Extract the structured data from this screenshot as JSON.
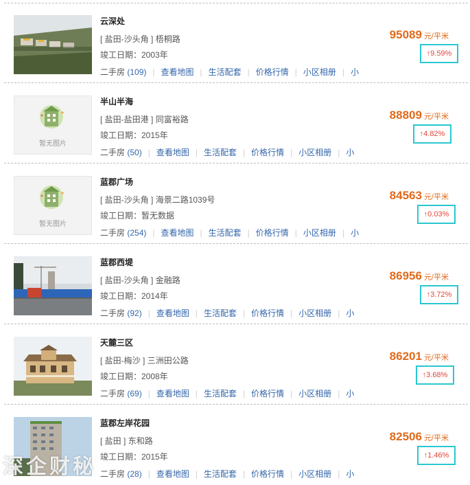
{
  "colors": {
    "price": "#e06a1b",
    "link": "#3366aa",
    "highlight_box": "#29c7d0",
    "change": "#e0453a"
  },
  "placeholder_text": "暂无图片",
  "unit": "元/平米",
  "links": {
    "second_hand": "二手房",
    "map": "查看地图",
    "life": "生活配套",
    "price_trend": "价格行情",
    "album": "小区相册",
    "more_cut": "小"
  },
  "items": [
    {
      "name": "云深处",
      "region": "[ 盐田-沙头角 ]",
      "road": "梧桐路",
      "year": "竣工日期：2003年",
      "count": "(109)",
      "price": "95089",
      "change": "↑9.59%",
      "image": "photo-hillside-villas"
    },
    {
      "name": "半山半海",
      "region": "[ 盐田-盐田港 ]",
      "road": "同富裕路",
      "year": "竣工日期：2015年",
      "count": "(50)",
      "price": "88809",
      "change": "↑4.82%",
      "image": "placeholder"
    },
    {
      "name": "蓝郡广场",
      "region": "[ 盐田-沙头角 ]",
      "road": "海景二路1039号",
      "year": "竣工日期：暂无数据",
      "count": "(254)",
      "price": "84563",
      "change": "↑0.03%",
      "image": "placeholder"
    },
    {
      "name": "蓝郡西堤",
      "region": "[ 盐田-沙头角 ]",
      "road": "金融路",
      "year": "竣工日期：2014年",
      "count": "(92)",
      "price": "86956",
      "change": "↑3.72%",
      "image": "photo-construction-site"
    },
    {
      "name": "天麓三区",
      "region": "[ 盐田-梅沙 ]",
      "road": "三洲田公路",
      "year": "竣工日期：2008年",
      "count": "(69)",
      "price": "86201",
      "change": "↑3.68%",
      "image": "photo-villa"
    },
    {
      "name": "蓝郡左岸花园",
      "region": "[ 盐田 ]",
      "road": "东和路",
      "year": "竣工日期：2015年",
      "count": "(28)",
      "price": "82506",
      "change": "↑1.46%",
      "image": "photo-tower"
    }
  ],
  "watermark": "深企财秘"
}
